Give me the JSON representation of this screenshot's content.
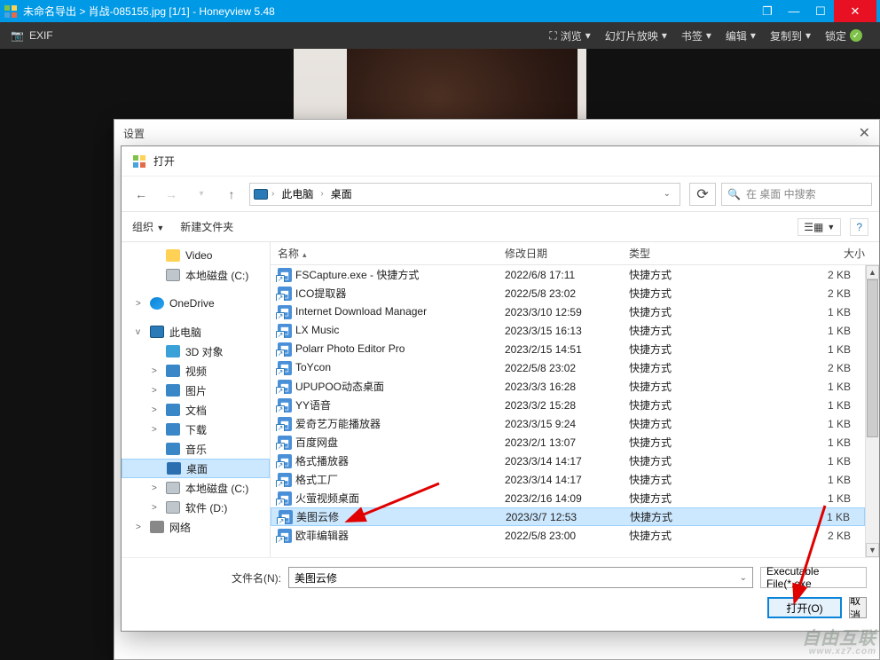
{
  "app": {
    "title": "未命名导出 > 肖战-085155.jpg [1/1] - Honeyview 5.48",
    "exif": "EXIF"
  },
  "menus": {
    "view": "浏览",
    "slideshow": "幻灯片放映",
    "bookmark": "书签",
    "edit": "编辑",
    "copy_to": "复制到",
    "lock": "锁定"
  },
  "settings": {
    "title": "设置"
  },
  "open_dialog": {
    "title": "打开",
    "back": "←",
    "forward": "→",
    "up": "↑",
    "breadcrumb": {
      "pc": "此电脑",
      "desktop": "桌面"
    },
    "refresh": "⟳",
    "search_placeholder": "在 桌面 中搜索",
    "organize": "组织",
    "new_folder": "新建文件夹",
    "cols": {
      "name": "名称",
      "date": "修改日期",
      "type": "类型",
      "size": "大小"
    },
    "filename_label": "文件名(N):",
    "filename_value": "美图云修",
    "filter": "Executable File(*.exe",
    "open_btn": "打开(O)",
    "cancel_btn": "取消"
  },
  "tree": [
    {
      "label": "Video",
      "ico": "ico-folder",
      "indent": true
    },
    {
      "label": "本地磁盘 (C:)",
      "ico": "ico-disk",
      "indent": true
    },
    {
      "label": "OneDrive",
      "ico": "ico-onedrive",
      "exp": ">"
    },
    {
      "label": "此电脑",
      "ico": "ico-pc",
      "exp": "v"
    },
    {
      "label": "3D 对象",
      "ico": "ico-3d",
      "indent": true
    },
    {
      "label": "视频",
      "ico": "ico-video",
      "indent": true,
      "exp": ">"
    },
    {
      "label": "图片",
      "ico": "ico-pic",
      "indent": true,
      "exp": ">"
    },
    {
      "label": "文档",
      "ico": "ico-doc",
      "indent": true,
      "exp": ">"
    },
    {
      "label": "下载",
      "ico": "ico-down",
      "indent": true,
      "exp": ">"
    },
    {
      "label": "音乐",
      "ico": "ico-music",
      "indent": true
    },
    {
      "label": "桌面",
      "ico": "ico-desk",
      "indent": true,
      "selected": true
    },
    {
      "label": "本地磁盘 (C:)",
      "ico": "ico-disk",
      "indent": true,
      "exp": ">"
    },
    {
      "label": "软件 (D:)",
      "ico": "ico-disk",
      "indent": true,
      "exp": ">"
    },
    {
      "label": "网络",
      "ico": "ico-net",
      "exp": ">"
    }
  ],
  "files": [
    {
      "name": "FSCapture.exe - 快捷方式",
      "date": "2022/6/8 17:11",
      "type": "快捷方式",
      "size": "2 KB"
    },
    {
      "name": "ICO提取器",
      "date": "2022/5/8 23:02",
      "type": "快捷方式",
      "size": "2 KB"
    },
    {
      "name": "Internet Download Manager",
      "date": "2023/3/10 12:59",
      "type": "快捷方式",
      "size": "1 KB"
    },
    {
      "name": "LX Music",
      "date": "2023/3/15 16:13",
      "type": "快捷方式",
      "size": "1 KB"
    },
    {
      "name": "Polarr Photo Editor Pro",
      "date": "2023/2/15 14:51",
      "type": "快捷方式",
      "size": "1 KB"
    },
    {
      "name": "ToYcon",
      "date": "2022/5/8 23:02",
      "type": "快捷方式",
      "size": "2 KB"
    },
    {
      "name": "UPUPOO动态桌面",
      "date": "2023/3/3 16:28",
      "type": "快捷方式",
      "size": "1 KB"
    },
    {
      "name": "YY语音",
      "date": "2023/3/2 15:28",
      "type": "快捷方式",
      "size": "1 KB"
    },
    {
      "name": "爱奇艺万能播放器",
      "date": "2023/3/15 9:24",
      "type": "快捷方式",
      "size": "1 KB"
    },
    {
      "name": "百度网盘",
      "date": "2023/2/1 13:07",
      "type": "快捷方式",
      "size": "1 KB"
    },
    {
      "name": "格式播放器",
      "date": "2023/3/14 14:17",
      "type": "快捷方式",
      "size": "1 KB"
    },
    {
      "name": "格式工厂",
      "date": "2023/3/14 14:17",
      "type": "快捷方式",
      "size": "1 KB"
    },
    {
      "name": "火萤视频桌面",
      "date": "2023/2/16 14:09",
      "type": "快捷方式",
      "size": "1 KB"
    },
    {
      "name": "美图云修",
      "date": "2023/3/7 12:53",
      "type": "快捷方式",
      "size": "1 KB",
      "selected": true
    },
    {
      "name": "欧菲编辑器",
      "date": "2022/5/8 23:00",
      "type": "快捷方式",
      "size": "2 KB"
    }
  ],
  "watermark": {
    "main": "自由互联",
    "sub": "www.xz7.com"
  }
}
